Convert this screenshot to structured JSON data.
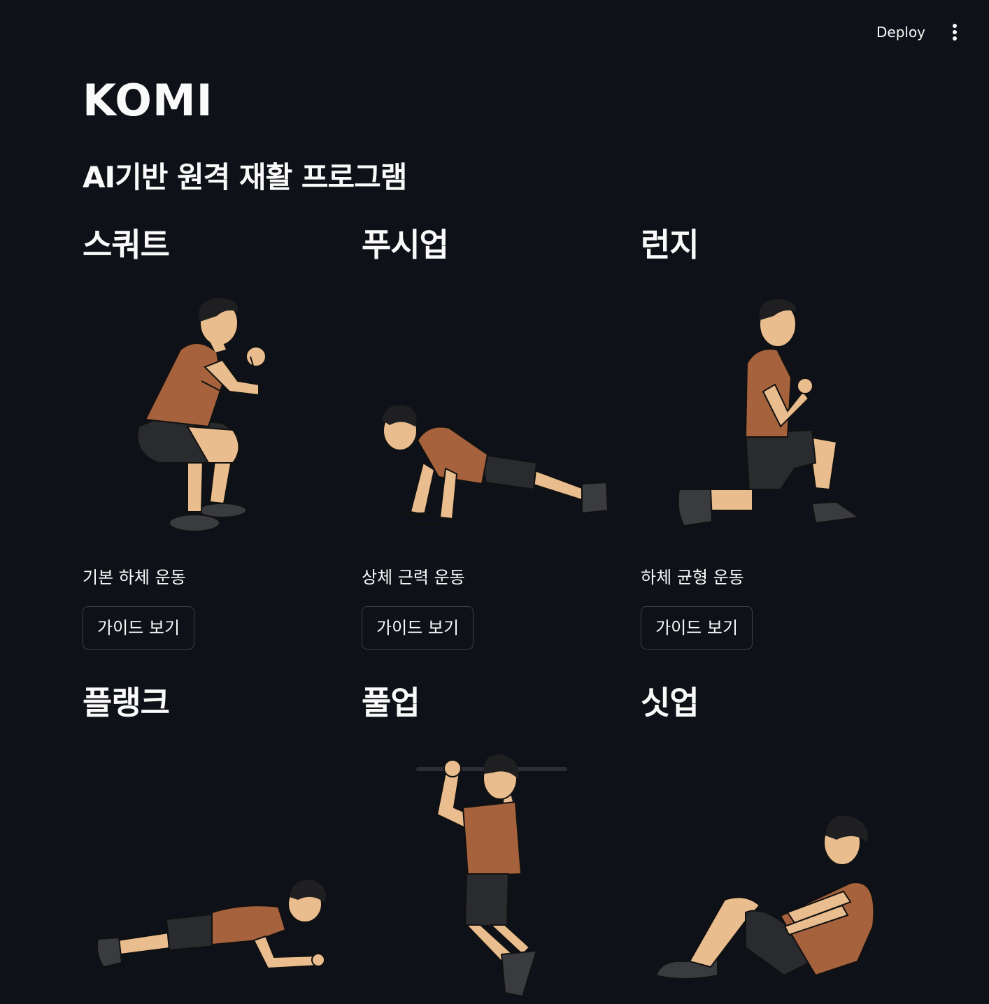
{
  "header": {
    "deploy_label": "Deploy",
    "menu_icon": "kebab-menu-icon"
  },
  "page": {
    "title": "KOMI",
    "subtitle": "AI기반 원격 재활 프로그램"
  },
  "exercises": [
    {
      "name": "스쿼트",
      "description": "기본 하체 운동",
      "button_label": "가이드 보기",
      "illustration": "squat-illustration"
    },
    {
      "name": "푸시업",
      "description": "상체 근력 운동",
      "button_label": "가이드 보기",
      "illustration": "pushup-illustration"
    },
    {
      "name": "런지",
      "description": "하체 균형 운동",
      "button_label": "가이드 보기",
      "illustration": "lunge-illustration"
    },
    {
      "name": "플랭크",
      "illustration": "plank-illustration"
    },
    {
      "name": "풀업",
      "illustration": "pullup-illustration"
    },
    {
      "name": "싯업",
      "illustration": "situp-illustration"
    }
  ],
  "colors": {
    "background": "#0e1117",
    "text": "#fafafa",
    "button_border": "#3d4049",
    "shirt": "#a5623c",
    "skin": "#e9bd8e",
    "shorts": "#2a2b2e",
    "hair": "#1f1f22"
  }
}
